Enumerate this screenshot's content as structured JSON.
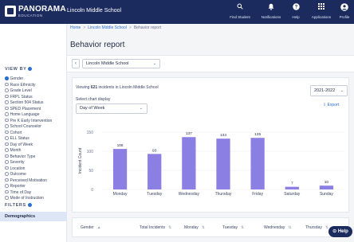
{
  "app": {
    "logo_name": "PANORAMA",
    "logo_sub": "EDUCATION",
    "school": "Lincoln Middle School"
  },
  "top_actions": [
    {
      "label": "Find Student",
      "icon": "search-icon"
    },
    {
      "label": "Notifications",
      "icon": "bell-icon"
    },
    {
      "label": "Help",
      "icon": "help-icon"
    },
    {
      "label": "Applications",
      "icon": "grid-icon"
    },
    {
      "label": "Profile",
      "icon": "user-icon"
    }
  ],
  "breadcrumb": {
    "home": "Home",
    "school": "Lincoln Middle School",
    "current": "Behavior report"
  },
  "page_title": "Behavior report",
  "school_selector": {
    "value": "Lincoln Middle School"
  },
  "sidebar": {
    "view_by_label": "VIEW BY",
    "items": [
      {
        "label": "Gender",
        "selected": true
      },
      {
        "label": "Race Ethnicity",
        "selected": false
      },
      {
        "label": "Grade Level",
        "selected": false
      },
      {
        "label": "FRPL Status",
        "selected": false
      },
      {
        "label": "Section 504 Status",
        "selected": false
      },
      {
        "label": "SPED Placement",
        "selected": false
      },
      {
        "label": "Home Language",
        "selected": false
      },
      {
        "label": "Pre K Early Intervention",
        "selected": false
      },
      {
        "label": "School Counselor",
        "selected": false
      },
      {
        "label": "Cohort",
        "selected": false
      },
      {
        "label": "ELL Status",
        "selected": false
      },
      {
        "label": "Day of Week",
        "selected": false
      },
      {
        "label": "Month",
        "selected": false
      },
      {
        "label": "Behavior Type",
        "selected": false
      },
      {
        "label": "Severity",
        "selected": false
      },
      {
        "label": "Location",
        "selected": false
      },
      {
        "label": "Outcome",
        "selected": false
      },
      {
        "label": "Perceived Motivation",
        "selected": false
      },
      {
        "label": "Reporter",
        "selected": false
      },
      {
        "label": "Time of Day",
        "selected": false
      },
      {
        "label": "Mode of Instruction",
        "selected": false
      }
    ],
    "filters_label": "FILTERS",
    "demographics_label": "Demographics"
  },
  "report": {
    "viewing_prefix": "Viewing ",
    "viewing_count": "621",
    "viewing_suffix": " incidents in Lincoln Middle School",
    "chart_display_label": "Select chart display",
    "chart_display_value": "Day of Week",
    "year_value": "2021-2022",
    "export_label": "Export"
  },
  "chart_data": {
    "type": "bar",
    "categories": [
      "Monday",
      "Tuesday",
      "Wednesday",
      "Thursday",
      "Friday",
      "Saturday",
      "Sunday"
    ],
    "values": [
      106,
      93,
      137,
      133,
      135,
      7,
      10
    ],
    "ylabel": "Incident Count",
    "xlabel": "",
    "ylim": [
      0,
      150
    ],
    "yticks": [
      0,
      50,
      100,
      150
    ],
    "bar_color": "#8b7fe3",
    "grid": true
  },
  "table": {
    "headers": [
      "Gender",
      "Total Incidents",
      "Monday",
      "Tuesday",
      "Wednesday",
      "Thursday"
    ]
  },
  "help_label": "Help",
  "colors": {
    "nav": "#1b2b5e",
    "accent": "#2c6fd6",
    "bar": "#8b7fe3"
  }
}
